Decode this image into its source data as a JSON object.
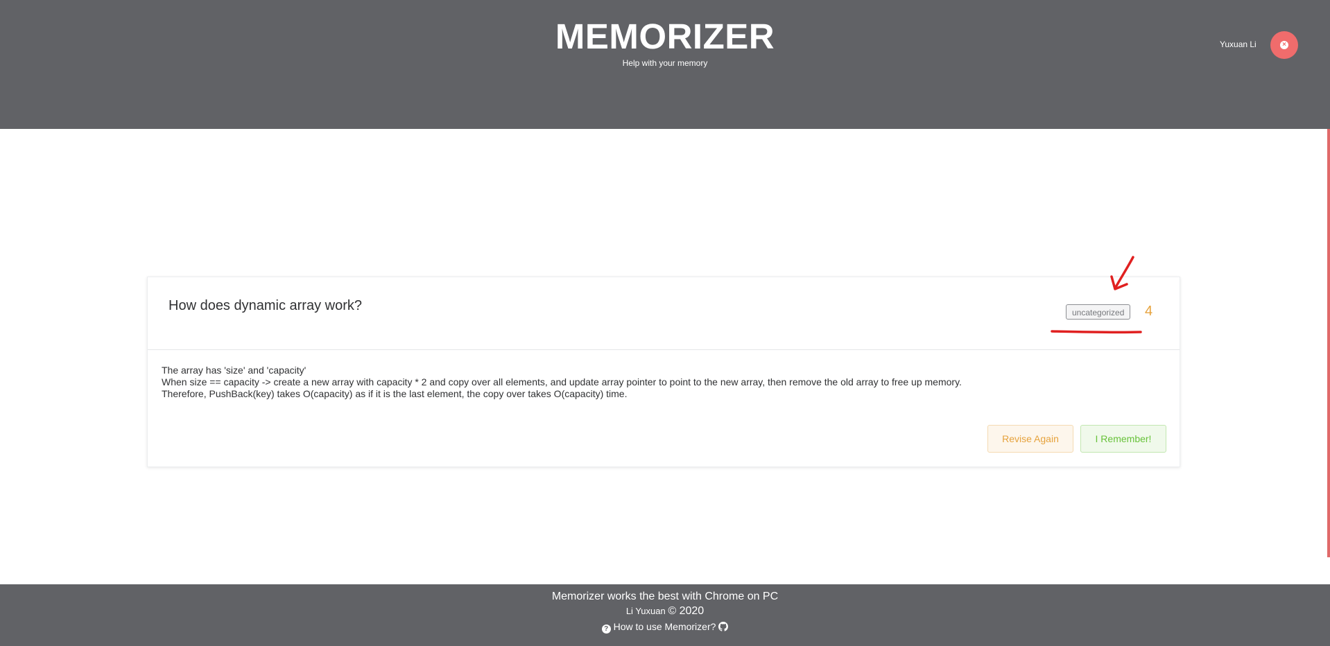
{
  "header": {
    "title": "MEMORIZER",
    "subtitle": "Help with your memory",
    "user_name": "Yuxuan Li",
    "logout_icon": "close-circle-icon"
  },
  "card": {
    "question": "How does dynamic array work?",
    "tag": "uncategorized",
    "count": "4",
    "answer_lines": [
      "The array has 'size' and 'capacity'",
      "When size == capacity -> create a new array with capacity * 2 and copy over all elements, and update array pointer to point to the new array, then remove the old array to free up memory.",
      "Therefore, PushBack(key) takes O(capacity) as if it is the last element, the copy over takes O(capacity) time."
    ],
    "revise_label": "Revise Again",
    "remember_label": "I Remember!"
  },
  "footer": {
    "line1": "Memorizer works the best with Chrome on PC",
    "author": "Li Yuxuan",
    "copyright": "© 2020",
    "help_link": "How to use Memorizer?",
    "help_icon": "question-circle-icon",
    "github_icon": "github-icon"
  },
  "colors": {
    "header_bg": "#616266",
    "accent_red": "#f06c6c",
    "warning": "#e6a23c",
    "success": "#67c23a",
    "annotation": "#e02020"
  }
}
